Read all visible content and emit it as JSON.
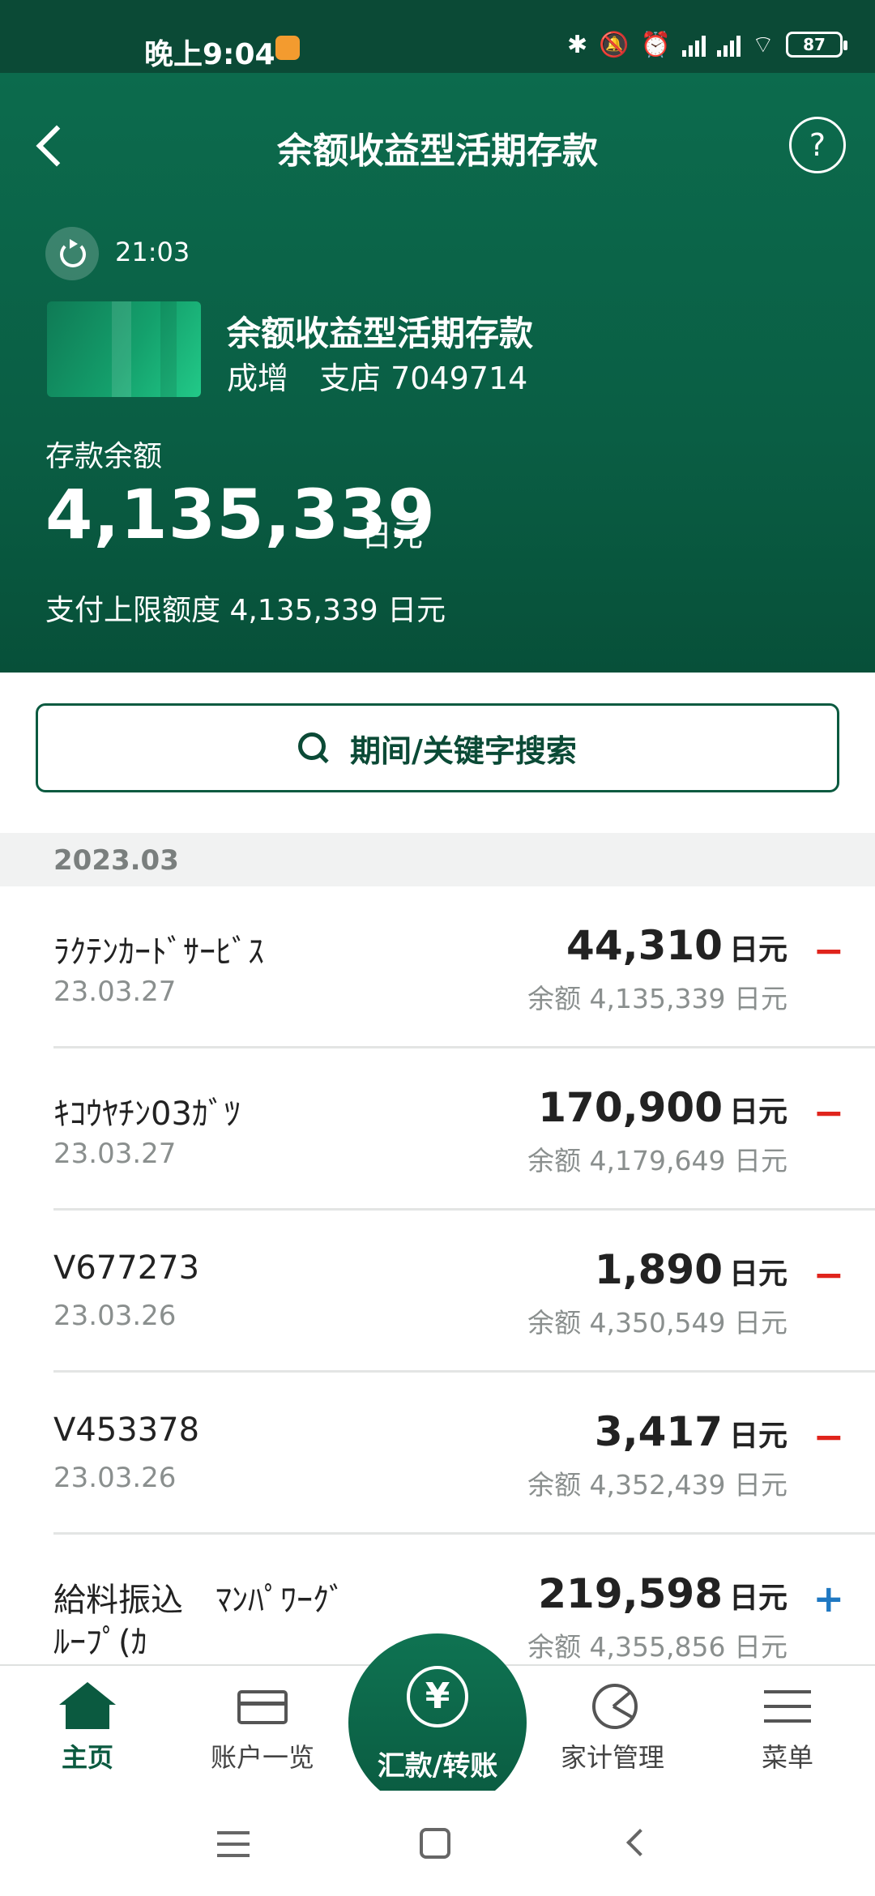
{
  "status_bar": {
    "time": "晚上9:04",
    "battery": "87"
  },
  "header": {
    "title": "余额收益型活期存款",
    "help": "?",
    "sync_time": "21:03",
    "account_name": "余额收益型活期存款",
    "branch_line": "成增　支店 7049714",
    "balance_label": "存款余额",
    "balance_amount": "4,135,339",
    "balance_unit": "日元",
    "payment_limit": "支付上限额度 4,135,339 日元"
  },
  "search": {
    "label": "期间/关键字搜索"
  },
  "month": {
    "label": "2023.03"
  },
  "transactions": [
    {
      "desc": "ﾗｸﾃﾝｶｰﾄﾞｻｰﾋﾞｽ",
      "date": "23.03.27",
      "amount": "44,310",
      "unit": "日元",
      "balance": "余额 4,135,339 日元",
      "sign": "−"
    },
    {
      "desc": "ｷｺｳﾔﾁﾝ03ｶﾞﾂ",
      "date": "23.03.27",
      "amount": "170,900",
      "unit": "日元",
      "balance": "余额 4,179,649 日元",
      "sign": "−"
    },
    {
      "desc": "V677273",
      "date": "23.03.26",
      "amount": "1,890",
      "unit": "日元",
      "balance": "余额 4,350,549 日元",
      "sign": "−"
    },
    {
      "desc": "V453378",
      "date": "23.03.26",
      "amount": "3,417",
      "unit": "日元",
      "balance": "余额 4,352,439 日元",
      "sign": "−"
    },
    {
      "desc": "給料振込　ﾏﾝﾊﾟﾜｰｸﾞ",
      "desc2": "ﾙｰﾌﾟ(ｶ",
      "amount": "219,598",
      "unit": "日元",
      "balance": "余额 4,355,856 日元",
      "sign": "+"
    }
  ],
  "nav": {
    "home": "主页",
    "accounts": "账户一览",
    "transfer": "汇款/转账",
    "transfer_icon": "¥",
    "budget": "家计管理",
    "menu": "菜单"
  },
  "colors": {
    "brand": "#0b5a40",
    "minus": "#e0241c",
    "plus": "#1f78c2"
  }
}
